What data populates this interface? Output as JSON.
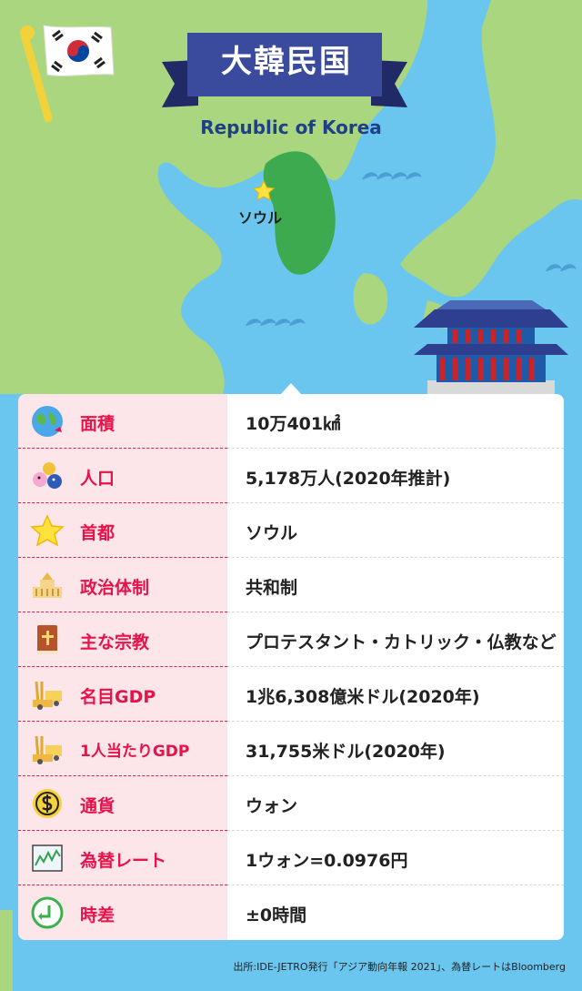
{
  "header": {
    "title": "大韓民国",
    "subtitle": "Republic of Korea",
    "capital_marker_label": "ソウル"
  },
  "info_rows": [
    {
      "label": "面積",
      "value": "10万401㎢",
      "icon": "globe-icon"
    },
    {
      "label": "人口",
      "value": "5,178万人(2020年推計)",
      "icon": "people-icon"
    },
    {
      "label": "首都",
      "value": "ソウル",
      "icon": "star-icon"
    },
    {
      "label": "政治体制",
      "value": "共和制",
      "icon": "parliament-icon"
    },
    {
      "label": "主な宗教",
      "value": "プロテスタント・カトリック・仏教など",
      "icon": "bible-icon"
    },
    {
      "label": "名目GDP",
      "value": "1兆6,308億米ドル(2020年)",
      "icon": "wheat-truck-icon"
    },
    {
      "label": "1人当たりGDP",
      "value": "31,755米ドル(2020年)",
      "icon": "wheat-truck-icon"
    },
    {
      "label": "通貨",
      "value": "ウォン",
      "icon": "coin-icon"
    },
    {
      "label": "為替レート",
      "value": "1ウォン=0.0976円",
      "icon": "chart-icon"
    },
    {
      "label": "時差",
      "value": "±0時間",
      "icon": "clock-arrow-icon"
    }
  ],
  "footer": {
    "source": "出所:IDE-JETRO発行「アジア動向年報 2021」、為替レートはBloomberg"
  },
  "colors": {
    "sea": "#6ac6ef",
    "land": "#a9d67e",
    "korea": "#3daa50",
    "label_red": "#e5134a",
    "banner_blue": "#2d3f8e",
    "label_bg": "#fde6ea"
  }
}
